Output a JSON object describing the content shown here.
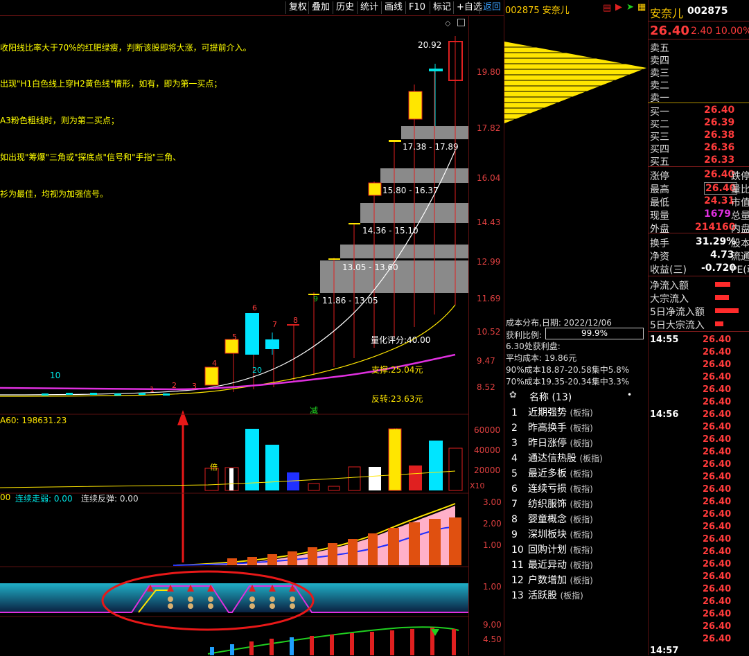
{
  "toolbar": {
    "buttons": [
      "复权",
      "叠加",
      "历史",
      "统计",
      "画线",
      "F10",
      "标记",
      "+自选",
      "返回"
    ]
  },
  "hints": [
    "收阳线比率大于70%的红肥绿瘦，判断该股即将大涨，可提前介入。",
    "出现\"H1白色线上穿H2黄色线\"情形，如有，即为第一买点；",
    "A3粉色粗线时，则为第二买点；",
    "如出现\"筹爆\"三角或\"探底点\"信号和\"手指\"三角、",
    "衫为最佳，均视为加强信号。"
  ],
  "price_axis": [
    "19.80",
    "17.82",
    "16.04",
    "14.43",
    "12.99",
    "11.69",
    "10.52",
    "9.47",
    "8.52"
  ],
  "price_high_label": "20.92",
  "chip_ranges": [
    "17.38 - 17.89",
    "15.80 - 16.37",
    "14.36 - 15.10",
    "13.05 - 13.60",
    "11.86 - 13.05"
  ],
  "candle_numbers": [
    "1",
    "2",
    "3",
    "4",
    "5",
    "6",
    "7",
    "8",
    "9",
    "10",
    "20"
  ],
  "main_labels": {
    "score": "量化评分:40.00",
    "support": "支撑:25.04元",
    "reversal": "反转:23.63元",
    "jian": "减"
  },
  "volume_panel": {
    "title": "A60: 198631.23",
    "axis": [
      "60000",
      "40000",
      "20000"
    ],
    "unit": "X10",
    "bei1": "倍",
    "bei2": "倍"
  },
  "indicator_panel": {
    "labels_prefix": "00",
    "label1": "连续走弱: 0.00",
    "label2": "连续反弹: 0.00",
    "axis": [
      "3.00",
      "2.00",
      "1.00"
    ]
  },
  "band_panel": {
    "axis": [
      "1.00"
    ]
  },
  "bottom_panel": {
    "axis": [
      "9.00",
      "4.50"
    ]
  },
  "middle": {
    "title": "002875 安奈儿",
    "cost": {
      "date_label": "成本分布,日期: 2022/12/06",
      "profit_label": "获利比例:",
      "profit_value": "99.9%",
      "profit_at": "6.30处获利盘:",
      "avg": "平均成本: 19.86元",
      "c90": "90%成本18.87-20.58集中5.8%",
      "c70": "70%成本19.35-20.34集中3.3%"
    },
    "sector_header": "名称 (13)",
    "sectors": [
      {
        "n": "1",
        "name": "近期强势",
        "tag": "(板指)"
      },
      {
        "n": "2",
        "name": "昨高换手",
        "tag": "(板指)"
      },
      {
        "n": "3",
        "name": "昨日涨停",
        "tag": "(板指)"
      },
      {
        "n": "4",
        "name": "通达信热股",
        "tag": "(板指)"
      },
      {
        "n": "5",
        "name": "最近多板",
        "tag": "(板指)"
      },
      {
        "n": "6",
        "name": "连续亏损",
        "tag": "(板指)"
      },
      {
        "n": "7",
        "name": "纺织服饰",
        "tag": "(板指)"
      },
      {
        "n": "8",
        "name": "婴童概念",
        "tag": "(板指)"
      },
      {
        "n": "9",
        "name": "深圳板块",
        "tag": "(板指)"
      },
      {
        "n": "10",
        "name": "回购计划",
        "tag": "(板指)"
      },
      {
        "n": "11",
        "name": "最近异动",
        "tag": "(板指)"
      },
      {
        "n": "12",
        "name": "户数增加",
        "tag": "(板指)"
      },
      {
        "n": "13",
        "name": "活跃股",
        "tag": "(板指)"
      }
    ]
  },
  "quote": {
    "name": "安奈儿",
    "code": "002875",
    "price": "26.40",
    "change": "2.40",
    "pct": "10.00%",
    "asks": [
      "卖五",
      "卖四",
      "卖三",
      "卖二",
      "卖一"
    ],
    "bids": [
      {
        "label": "买一",
        "price": "26.40"
      },
      {
        "label": "买二",
        "price": "26.39"
      },
      {
        "label": "买三",
        "price": "26.38"
      },
      {
        "label": "买四",
        "price": "26.36"
      },
      {
        "label": "买五",
        "price": "26.33"
      }
    ],
    "stats": [
      {
        "label": "涨停",
        "value": "26.40",
        "tail": "跌停"
      },
      {
        "label": "最高",
        "value": "26.40",
        "tail": "量比"
      },
      {
        "label": "最低",
        "value": "24.31",
        "tail": "市值"
      },
      {
        "label": "现量",
        "value": "1679",
        "tail": "总量"
      },
      {
        "label": "外盘",
        "value": "214160",
        "tail": "内盘"
      }
    ],
    "stats2": [
      {
        "label": "换手",
        "value": "31.29%",
        "tail": "股本"
      },
      {
        "label": "净资",
        "value": "4.73",
        "tail": "流通"
      },
      {
        "label": "收益(三)",
        "value": "-0.720",
        "tail": "PE(动"
      }
    ],
    "flows": [
      "净流入额",
      "大宗流入",
      "5日净流入额",
      "5日大宗流入"
    ],
    "ticks": {
      "t1": "14:55",
      "t2": "14:56",
      "t3": "14:57",
      "price": "26.40"
    }
  }
}
